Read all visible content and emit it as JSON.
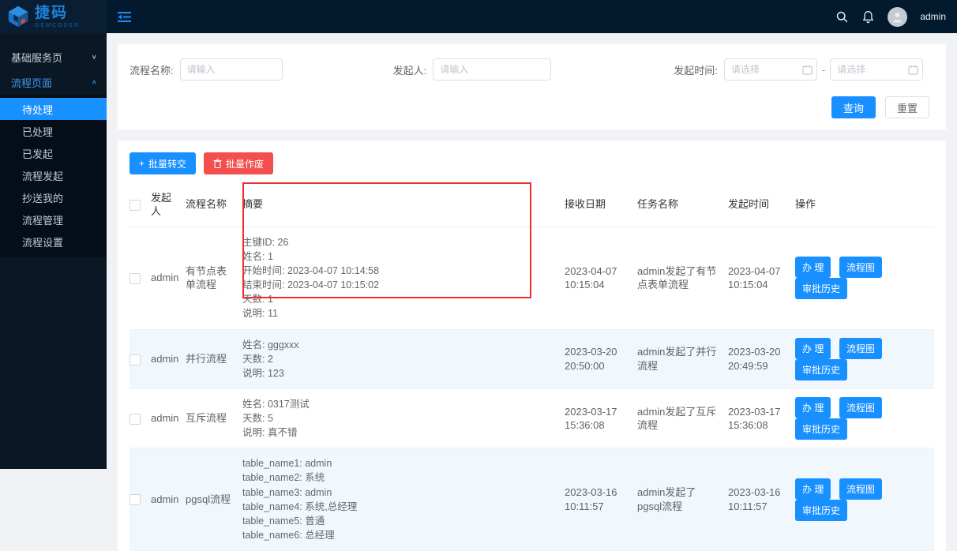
{
  "brand": {
    "name": "捷码",
    "subname": "GEMCODER"
  },
  "topbar": {
    "admin_label": "admin"
  },
  "icons": {
    "chevron_down": "∨",
    "chevron_up": "∧",
    "plus": "+"
  },
  "sidebar": {
    "groups": [
      {
        "label": "基础服务页"
      },
      {
        "label": "流程页面"
      }
    ],
    "items": [
      {
        "label": "待处理"
      },
      {
        "label": "已处理"
      },
      {
        "label": "已发起"
      },
      {
        "label": "流程发起"
      },
      {
        "label": "抄送我的"
      },
      {
        "label": "流程管理"
      },
      {
        "label": "流程设置"
      }
    ]
  },
  "filters": {
    "process_name_label": "流程名称:",
    "process_name_placeholder": "请输入",
    "initiator_label": "发起人:",
    "initiator_placeholder": "请输入",
    "start_time_label": "发起时间:",
    "date_start_placeholder": "请选择",
    "date_end_placeholder": "请选择",
    "separator": "-",
    "search_button": "查询",
    "reset_button": "重置"
  },
  "toolbar": {
    "batch_transfer": "批量转交",
    "batch_discard": "批量作废"
  },
  "table": {
    "headers": {
      "initiator": "发起人",
      "process_name": "流程名称",
      "summary": "摘要",
      "receive_date": "接收日期",
      "task_name": "任务名称",
      "start_time": "发起时间",
      "actions": "操作"
    },
    "action_buttons": {
      "handle": "办 理",
      "flow_chart": "流程图",
      "approval_history": "审批历史"
    },
    "rows": [
      {
        "initiator": "admin",
        "process_name": "有节点表单流程",
        "summary": "主键ID: 26\n姓名: 1\n开始时间: 2023-04-07 10:14:58\n结束时间: 2023-04-07 10:15:02\n天数: 1\n说明: 11",
        "receive_date": "2023-04-07 10:15:04",
        "task_name": "admin发起了有节点表单流程",
        "start_time": "2023-04-07 10:15:04"
      },
      {
        "initiator": "admin",
        "process_name": "并行流程",
        "summary": "姓名: gggxxx\n天数: 2\n说明: 123",
        "receive_date": "2023-03-20 20:50:00",
        "task_name": "admin发起了并行流程",
        "start_time": "2023-03-20 20:49:59"
      },
      {
        "initiator": "admin",
        "process_name": "互斥流程",
        "summary": "姓名: 0317测试\n天数: 5\n说明: 真不错",
        "receive_date": "2023-03-17 15:36:08",
        "task_name": "admin发起了互斥流程",
        "start_time": "2023-03-17 15:36:08"
      },
      {
        "initiator": "admin",
        "process_name": "pgsql流程",
        "summary": "table_name1: admin\ntable_name2: 系统\ntable_name3: admin\ntable_name4: 系统,总经理\ntable_name5: 普通\ntable_name6: 总经理",
        "receive_date": "2023-03-16 10:11:57",
        "task_name": "admin发起了pgsql流程",
        "start_time": "2023-03-16 10:11:57"
      }
    ]
  }
}
